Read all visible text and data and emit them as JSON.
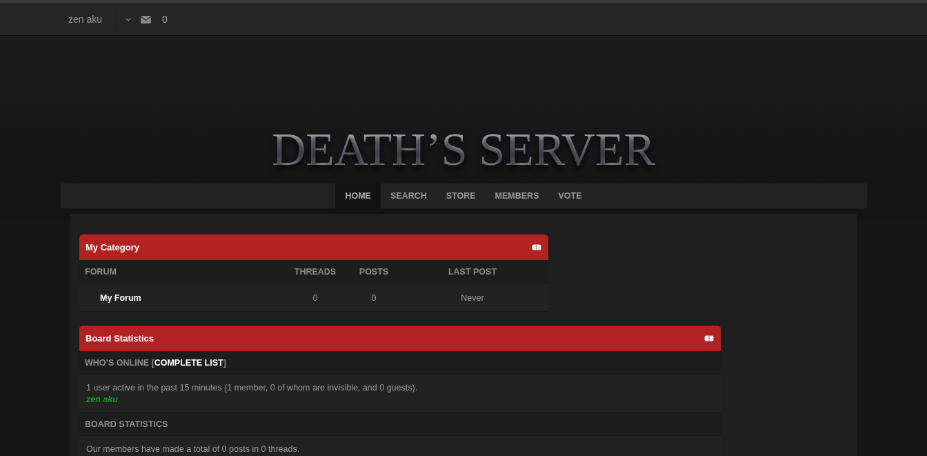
{
  "top_bar": {
    "user": "zen aku",
    "messages_count": "0"
  },
  "logo": {
    "text": "DEATH’S SERVER"
  },
  "nav": [
    {
      "label": "HOME",
      "selected": true
    },
    {
      "label": "SEARCH",
      "selected": false
    },
    {
      "label": "STORE",
      "selected": false
    },
    {
      "label": "MEMBERS",
      "selected": false
    },
    {
      "label": "VOTE",
      "selected": false
    }
  ],
  "category": {
    "title": "My Category",
    "columns": [
      "FORUM",
      "THREADS",
      "POSTS",
      "LAST POST"
    ],
    "rows": [
      {
        "forum": "My Forum",
        "threads": "0",
        "posts": "0",
        "last_post": "Never"
      }
    ]
  },
  "board_statistics": {
    "title": "Board Statistics",
    "whos_online": {
      "label_start": "WHO’S ONLINE [",
      "link": "COMPLETE LIST",
      "label_end": "]"
    },
    "online_summary": "1 user active in the past 15 minutes (1 member, 0 of whom are invisible, and 0 guests).",
    "online_users": [
      {
        "name": "zen aku",
        "color": "#1a9a1a"
      }
    ],
    "stats_heading": "BOARD STATISTICS",
    "stats_text": "Our members have made a total of 0 posts in 0 threads."
  }
}
